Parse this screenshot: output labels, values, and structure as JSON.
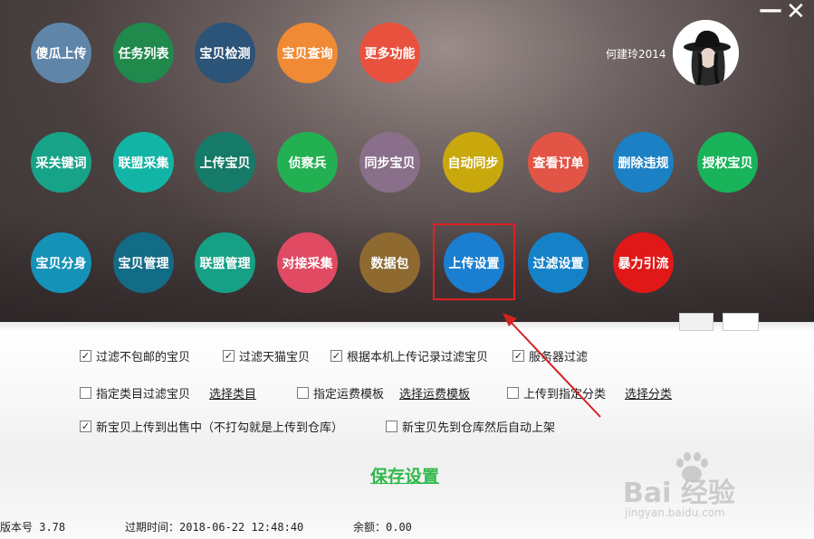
{
  "window": {
    "minimize_icon": "minimize-icon",
    "close_icon": "close-icon"
  },
  "user": {
    "name": "何建玲2014"
  },
  "buttons": [
    {
      "id": "shagua",
      "label": "傻瓜上传",
      "color": "#5f86a8"
    },
    {
      "id": "tasklist",
      "label": "任务列表",
      "color": "#1f8a4c"
    },
    {
      "id": "detect",
      "label": "宝贝检测",
      "color": "#2c5378"
    },
    {
      "id": "query",
      "label": "宝贝查询",
      "color": "#f08a34"
    },
    {
      "id": "more",
      "label": "更多功能",
      "color": "#e8513d"
    },
    {
      "id": "keywords",
      "label": "采关键词",
      "color": "#17a387"
    },
    {
      "id": "alliance-collect",
      "label": "联盟采集",
      "color": "#12b5a5"
    },
    {
      "id": "upload-item",
      "label": "上传宝贝",
      "color": "#157a68"
    },
    {
      "id": "scout",
      "label": "侦察兵",
      "color": "#22b052"
    },
    {
      "id": "sync-item",
      "label": "同步宝贝",
      "color": "#8a6f8a"
    },
    {
      "id": "auto-sync",
      "label": "自动同步",
      "color": "#c9a80e"
    },
    {
      "id": "view-order",
      "label": "查看订单",
      "color": "#e25445"
    },
    {
      "id": "delete-violation",
      "label": "删除违规",
      "color": "#1b80c4"
    },
    {
      "id": "authorize",
      "label": "授权宝贝",
      "color": "#19b35a"
    },
    {
      "id": "split",
      "label": "宝贝分身",
      "color": "#1592b8"
    },
    {
      "id": "manage",
      "label": "宝贝管理",
      "color": "#136c86"
    },
    {
      "id": "alliance-manage",
      "label": "联盟管理",
      "color": "#16a085"
    },
    {
      "id": "dock-collect",
      "label": "对接采集",
      "color": "#e04a63"
    },
    {
      "id": "data-pack",
      "label": "数据包",
      "color": "#8e6a30"
    },
    {
      "id": "upload-settings",
      "label": "上传设置",
      "color": "#1a7fd0"
    },
    {
      "id": "filter-settings",
      "label": "过滤设置",
      "color": "#1582c8"
    },
    {
      "id": "traffic",
      "label": "暴力引流",
      "color": "#e01818"
    }
  ],
  "options": {
    "row1": [
      {
        "label": "过滤不包邮的宝贝",
        "checked": true
      },
      {
        "label": "过滤天猫宝贝",
        "checked": true
      },
      {
        "label": "根据本机上传记录过滤宝贝",
        "checked": true
      },
      {
        "label": "服务器过滤",
        "checked": true
      }
    ],
    "row2": [
      {
        "label": "指定类目过滤宝贝",
        "checked": false,
        "link": "选择类目"
      },
      {
        "label": "指定运费模板",
        "checked": false,
        "link": "选择运费模板"
      },
      {
        "label": "上传到指定分类",
        "checked": false,
        "link": "选择分类"
      }
    ],
    "row3": [
      {
        "label": "新宝贝上传到出售中（不打勾就是上传到仓库）",
        "checked": true
      },
      {
        "label": "新宝贝先到仓库然后自动上架",
        "checked": false
      }
    ]
  },
  "save_label": "保存设置",
  "status": {
    "version": "版本号 3.78",
    "expire": "过期时间：2018-06-22 12:48:40",
    "balance": "余额：0.00"
  },
  "watermark": {
    "logo": "Bai 经验",
    "url": "jingyan.baidu.com"
  },
  "colors": {
    "highlight": "#e02020",
    "save_green": "#2fb84a"
  }
}
